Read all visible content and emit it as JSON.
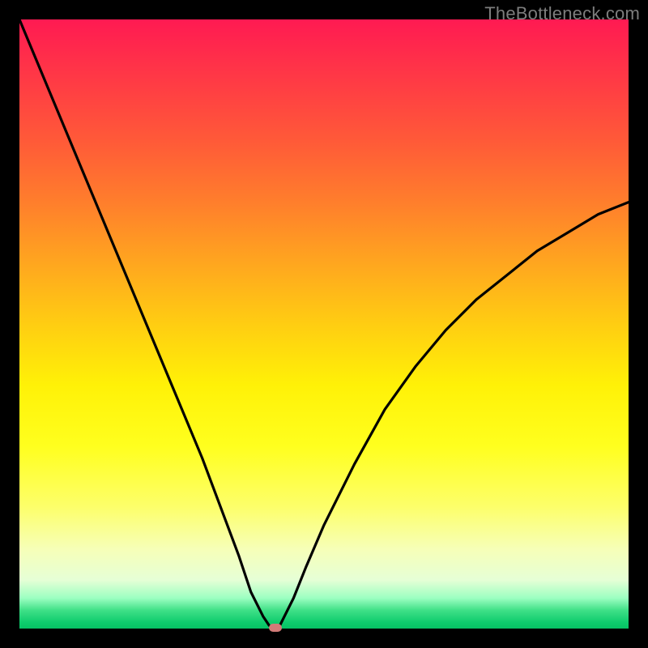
{
  "watermark": "TheBottleneck.com",
  "colors": {
    "frame": "#000000",
    "curve": "#000000",
    "marker": "#d17b78"
  },
  "chart_data": {
    "type": "line",
    "title": "",
    "xlabel": "",
    "ylabel": "",
    "xlim": [
      0,
      100
    ],
    "ylim": [
      0,
      100
    ],
    "grid": false,
    "series": [
      {
        "name": "bottleneck-curve",
        "x": [
          0,
          5,
          10,
          15,
          20,
          25,
          30,
          33,
          36,
          38,
          40,
          41,
          42,
          42.5,
          43,
          45,
          47,
          50,
          55,
          60,
          65,
          70,
          75,
          80,
          85,
          90,
          95,
          100
        ],
        "values": [
          100,
          88,
          76,
          64,
          52,
          40,
          28,
          20,
          12,
          6,
          2,
          0.5,
          0,
          0,
          1,
          5,
          10,
          17,
          27,
          36,
          43,
          49,
          54,
          58,
          62,
          65,
          68,
          70
        ]
      }
    ],
    "annotations": [
      {
        "name": "optimal-marker",
        "x": 42,
        "y": 0
      }
    ],
    "background_gradient": {
      "direction": "vertical",
      "stops": [
        {
          "pos": 0,
          "color": "#ff1a52"
        },
        {
          "pos": 50,
          "color": "#ffcd12"
        },
        {
          "pos": 80,
          "color": "#fdff6a"
        },
        {
          "pos": 97,
          "color": "#3fe087"
        },
        {
          "pos": 100,
          "color": "#07c264"
        }
      ]
    }
  }
}
